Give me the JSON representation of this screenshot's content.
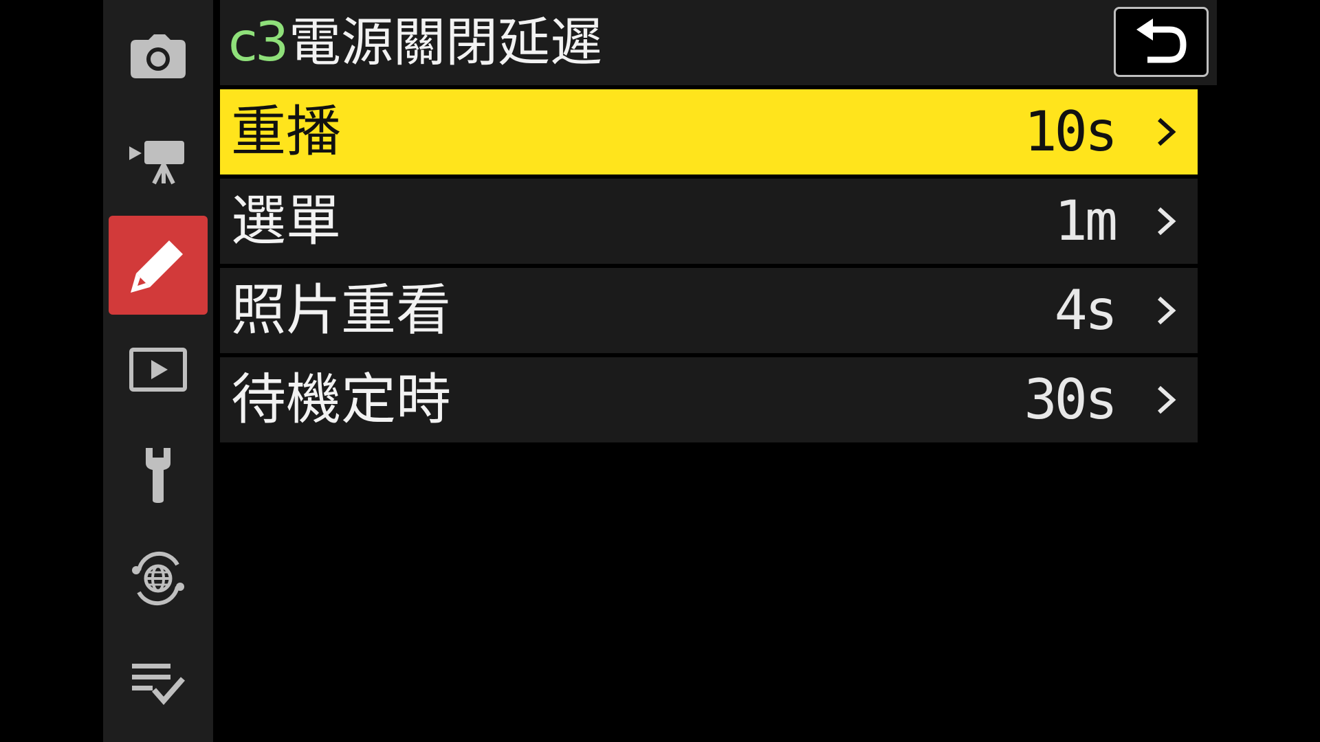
{
  "header": {
    "code": "c3",
    "title": "電源關閉延遲",
    "back_icon": "return-arrow-icon"
  },
  "sidebar": {
    "tabs": [
      {
        "name": "photo-shooting-menu",
        "icon": "camera-icon",
        "active": false
      },
      {
        "name": "video-recording-menu",
        "icon": "video-camera-icon",
        "active": false
      },
      {
        "name": "custom-settings-menu",
        "icon": "pencil-icon",
        "active": true
      },
      {
        "name": "playback-menu",
        "icon": "play-icon",
        "active": false
      },
      {
        "name": "setup-menu",
        "icon": "wrench-icon",
        "active": false
      },
      {
        "name": "network-menu",
        "icon": "globe-icon",
        "active": false
      },
      {
        "name": "my-menu",
        "icon": "checklist-icon",
        "active": false
      }
    ]
  },
  "menu": {
    "items": [
      {
        "label": "重播",
        "value": "10s",
        "selected": true
      },
      {
        "label": "選單",
        "value": "1m",
        "selected": false
      },
      {
        "label": "照片重看",
        "value": "4s",
        "selected": false
      },
      {
        "label": "待機定時",
        "value": "30s",
        "selected": false
      }
    ]
  },
  "colors": {
    "selected_row": "#ffe41c",
    "active_tab": "#d23a3a",
    "code_green": "#8fe07a"
  }
}
